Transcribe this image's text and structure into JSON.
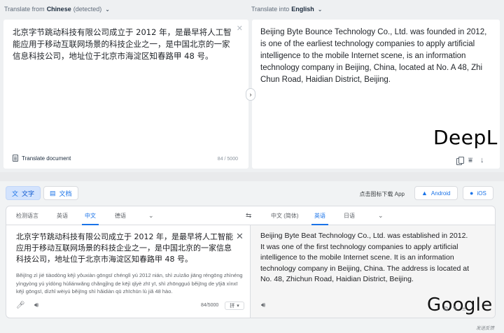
{
  "deepl": {
    "source_header": {
      "prefix": "Translate from",
      "lang": "Chinese",
      "suffix": "(detected)"
    },
    "target_header": {
      "prefix": "Translate into",
      "lang": "English"
    },
    "source_text": "北京字节跳动科技有限公司成立于 2012 年，是最早将人工智能应用于移动互联网场景的科技企业之一，是中国北京的一家信息科技公司，地址位于北京市海淀区知春路甲 48 号。",
    "translate_document_label": "Translate document",
    "char_count": "84 / 5000",
    "target_text": "Beijing Byte Bounce Technology Co., Ltd. was founded in 2012, is one of the earliest technology companies to apply artificial intelligence to the mobile Internet scene, is an information technology company in Beijing, China, located at No. A 48, Zhi Chun Road, Haidian District, Beijing.",
    "logo_text": "DeepL"
  },
  "google": {
    "modes": {
      "text": "文字",
      "docs": "文档"
    },
    "app_hint": "点击图标下载 App",
    "apps": {
      "android": "Android",
      "ios": "iOS"
    },
    "source_langs": [
      "检测语言",
      "英语",
      "中文",
      "德语"
    ],
    "target_langs": [
      "中文 (简体)",
      "英语",
      "日语"
    ],
    "source_text": "北京字节跳动科技有限公司成立于 2012 年，是最早将人工智能应用于移动互联网场景的科技企业之一，是中国北京的一家信息科技公司，地址位于北京市海淀区知春路甲 48 号。",
    "transliteration": "Běijīng zì jié tiàodòng kējì yǒuxiàn gōngsī chénglì yú 2012 nián, shì zuìzǎo jiāng réngōng zhìnéng yìngyòng yú yídòng hùliánwǎng chǎngjǐng de kējì qǐyè zhī yī, shì zhōngguó běijīng de yījiā xìnxī kējì gōngsī, dìzhǐ wèiyú běijīng shì hǎidiàn qū zhīchūn lù jiǎ 48 hào.",
    "char_count": "84/5000",
    "ime_label": "拼",
    "target_text": "Beijing Byte Beat Technology Co., Ltd. was established in 2012. It was one of the first technology companies to apply artificial intelligence to the mobile Internet scene. It is an information technology company in Beijing, China. The address is located at No. 48, Zhichun Road, Haidian District, Beijing.",
    "logo_text": "Google",
    "feedback_label": "发送反馈"
  },
  "icons": {
    "chevron": "chevron-down-icon",
    "close": "close-icon",
    "swap": "swap-icon",
    "mic": "microphone-icon",
    "speaker": "speaker-icon",
    "copy": "copy-icon",
    "share": "share-icon",
    "download": "download-icon"
  }
}
